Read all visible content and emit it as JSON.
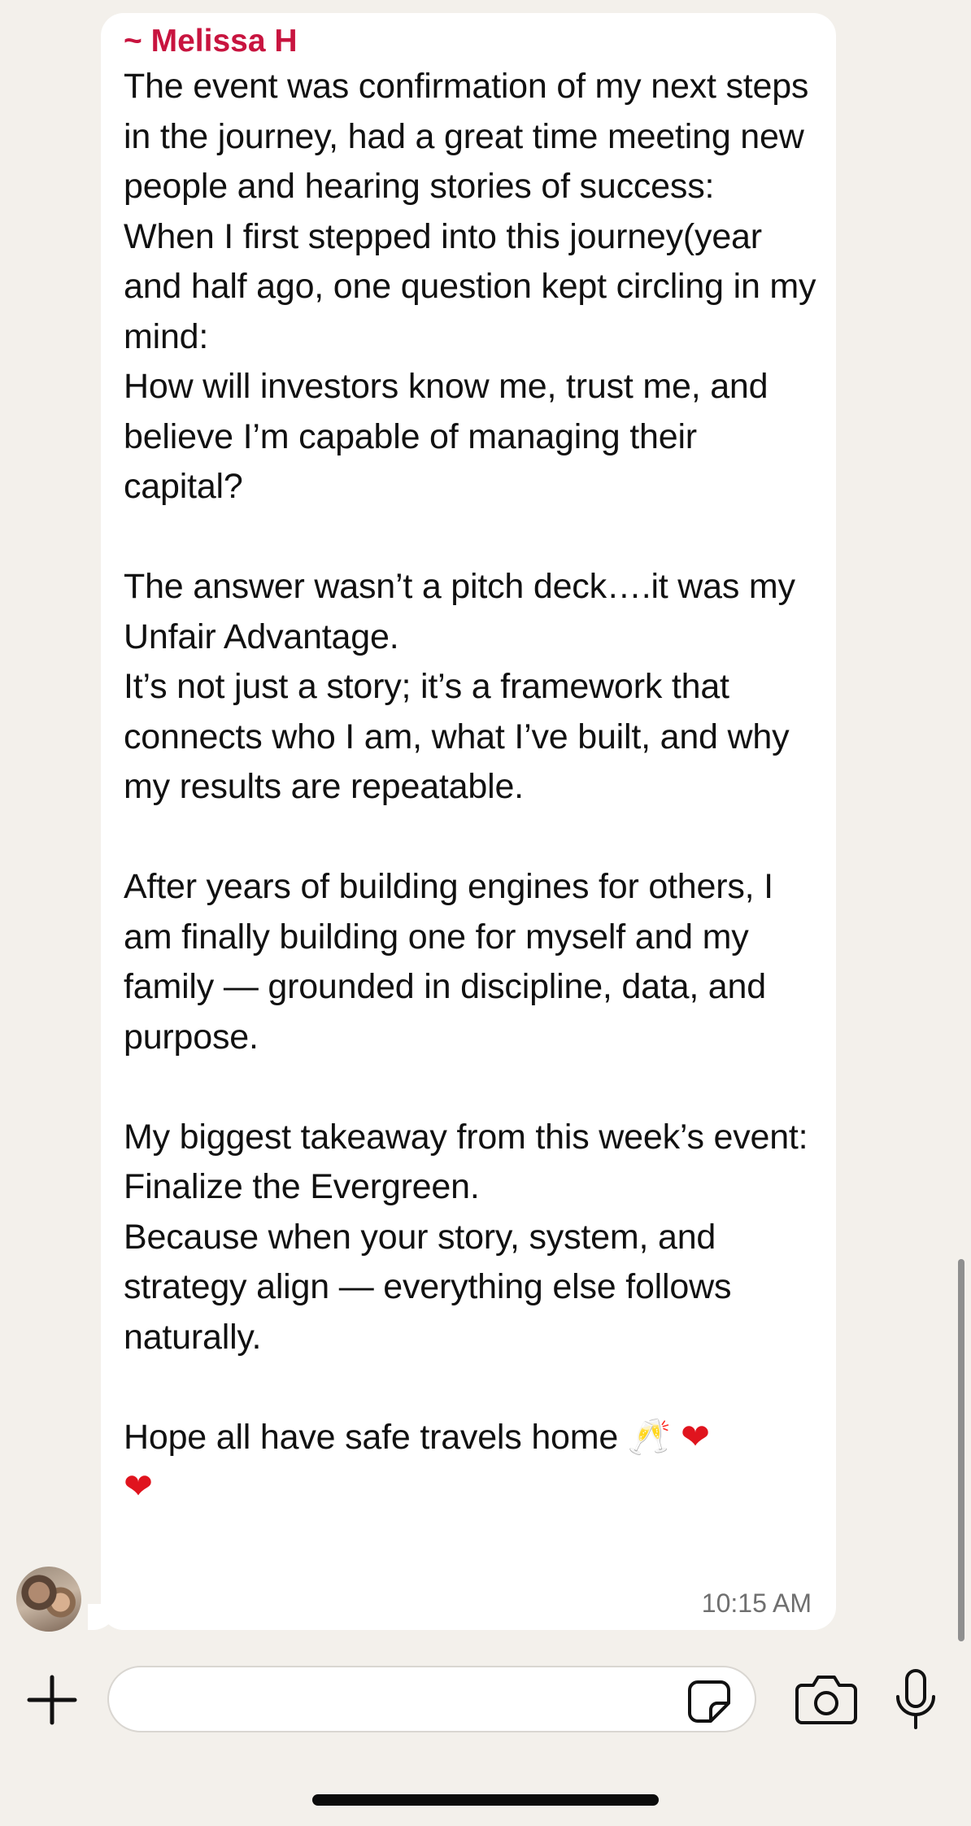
{
  "message": {
    "sender": "~ Melissa H",
    "body": "The event was confirmation of my next steps in the journey, had a great time meeting new people and hearing stories of success:\nWhen I first stepped into this journey(year and half ago, one question kept circling in my mind:\nHow will investors know me, trust me, and believe I’m capable of managing their capital?\n\nThe answer wasn’t a pitch deck….it was my Unfair Advantage.\nIt’s not just a story; it’s a framework that connects who I am, what I’ve built, and why my results are repeatable.\n\nAfter years of building engines for others, I am finally building one for myself and my family — grounded in discipline, data, and purpose.\n\nMy biggest takeaway from this week’s event:\nFinalize the Evergreen.\nBecause when your story, system, and strategy align — everything else follows naturally.\n\nHope all have safe travels home",
    "emoji_line_1": "🥂",
    "emoji_heart_1": "❤",
    "emoji_heart_2": "❤",
    "timestamp": "10:15 AM"
  },
  "composer": {
    "input_value": "",
    "input_placeholder": "",
    "icons": [
      "plus-icon",
      "sticker-icon",
      "camera-icon",
      "microphone-icon"
    ]
  },
  "colors": {
    "background": "#f3f0eb",
    "bubble": "#ffffff",
    "sender_name": "#c8143f",
    "heart": "#e0141e"
  }
}
